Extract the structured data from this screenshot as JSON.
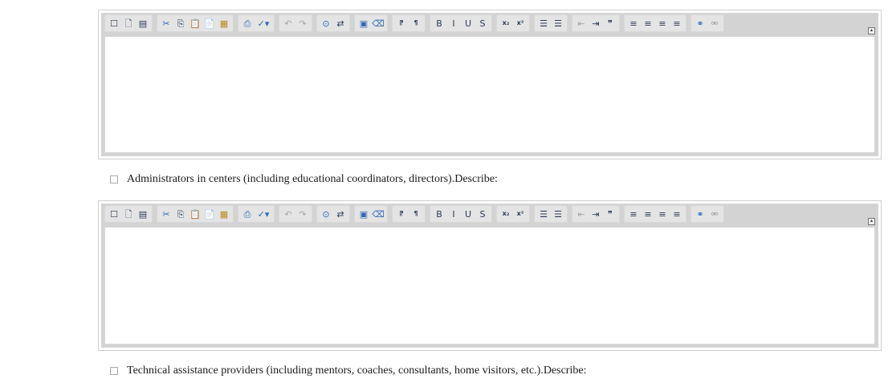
{
  "toolbar_icons": [
    {
      "name": "new-page-icon",
      "glyph": "☐"
    },
    {
      "name": "preview-icon",
      "glyph": "🗋"
    },
    {
      "name": "templates-icon",
      "glyph": "▤"
    },
    {
      "name": "cut-icon",
      "glyph": "✂"
    },
    {
      "name": "copy-icon",
      "glyph": "⎘"
    },
    {
      "name": "paste-icon",
      "glyph": "📋"
    },
    {
      "name": "paste-text-icon",
      "glyph": "📄"
    },
    {
      "name": "paste-word-icon",
      "glyph": "▦"
    },
    {
      "name": "print-icon",
      "glyph": "⎙"
    },
    {
      "name": "spellcheck-icon",
      "glyph": "✓▾"
    },
    {
      "name": "undo-icon",
      "glyph": "↶"
    },
    {
      "name": "redo-icon",
      "glyph": "↷"
    },
    {
      "name": "find-icon",
      "glyph": "⊙"
    },
    {
      "name": "replace-icon",
      "glyph": "⇄"
    },
    {
      "name": "select-all-icon",
      "glyph": "▣"
    },
    {
      "name": "remove-format-icon",
      "glyph": "⌫"
    },
    {
      "name": "ltr-icon",
      "glyph": "⁋"
    },
    {
      "name": "rtl-icon",
      "glyph": "¶"
    },
    {
      "name": "bold-icon",
      "glyph": "B"
    },
    {
      "name": "italic-icon",
      "glyph": "I"
    },
    {
      "name": "underline-icon",
      "glyph": "U"
    },
    {
      "name": "strikethrough-icon",
      "glyph": "S"
    },
    {
      "name": "subscript-icon",
      "glyph": "x₂"
    },
    {
      "name": "superscript-icon",
      "glyph": "x²"
    },
    {
      "name": "numbered-list-icon",
      "glyph": "☰"
    },
    {
      "name": "bulleted-list-icon",
      "glyph": "☰"
    },
    {
      "name": "outdent-icon",
      "glyph": "⇤"
    },
    {
      "name": "indent-icon",
      "glyph": "⇥"
    },
    {
      "name": "blockquote-icon",
      "glyph": "❞"
    },
    {
      "name": "align-left-icon",
      "glyph": "≡"
    },
    {
      "name": "align-center-icon",
      "glyph": "≡"
    },
    {
      "name": "align-right-icon",
      "glyph": "≡"
    },
    {
      "name": "justify-icon",
      "glyph": "≡"
    },
    {
      "name": "link-icon",
      "glyph": "⚭"
    },
    {
      "name": "unlink-icon",
      "glyph": "⚮"
    }
  ],
  "editors": [
    {
      "id": "editor-1",
      "content": ""
    },
    {
      "id": "editor-2",
      "content": ""
    }
  ],
  "checkboxes": [
    {
      "label": "Administrators in centers (including educational coordinators, directors).Describe:",
      "checked": false
    },
    {
      "label": "Technical assistance providers (including mentors, coaches, consultants, home visitors, etc.).Describe:",
      "checked": false
    }
  ]
}
